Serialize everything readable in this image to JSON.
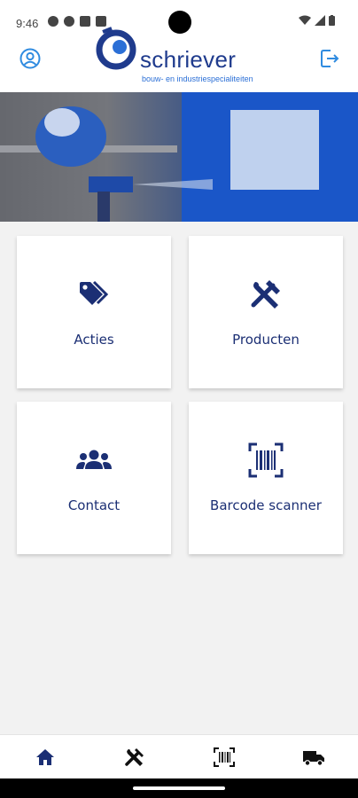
{
  "status_bar": {
    "time": "9:46"
  },
  "header": {
    "brand_name": "schriever",
    "brand_tagline": "bouw- en industriespecialiteiten",
    "user_icon": "user-circle-icon",
    "logout_icon": "logout-icon"
  },
  "tiles": [
    {
      "label": "Acties",
      "icon": "tags-icon"
    },
    {
      "label": "Producten",
      "icon": "tools-icon"
    },
    {
      "label": "Contact",
      "icon": "users-icon"
    },
    {
      "label": "Barcode scanner",
      "icon": "barcode-icon"
    }
  ],
  "bottom_nav": [
    {
      "icon": "home-icon",
      "active": true
    },
    {
      "icon": "tools-icon",
      "active": false
    },
    {
      "icon": "barcode-icon",
      "active": false
    },
    {
      "icon": "truck-icon",
      "active": false
    }
  ],
  "colors": {
    "brand_dark": "#1b2f74",
    "brand_blue": "#2b6fd6",
    "background": "#f2f2f2"
  }
}
